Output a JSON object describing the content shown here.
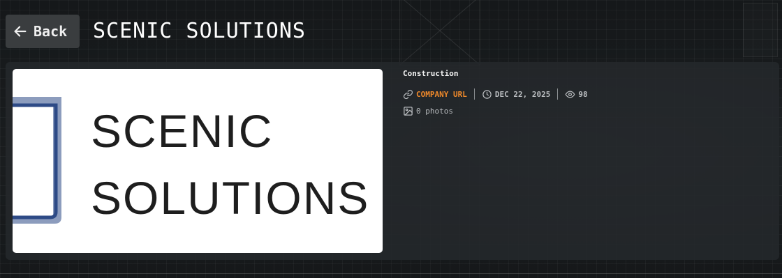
{
  "header": {
    "back_label": "Back",
    "title": "SCENIC SOLUTIONS"
  },
  "listing": {
    "category": "Construction",
    "company_url_label": "COMPANY URL",
    "date": "DEC 22, 2025",
    "views": "98",
    "photos": "0 photos",
    "logo": {
      "line1": "SCENIC",
      "line2": "SOLUTIONS",
      "mark_color": "#2e4a86"
    }
  },
  "colors": {
    "accent": "#f08a2b",
    "background": "#16191b",
    "card": "#24282b"
  }
}
